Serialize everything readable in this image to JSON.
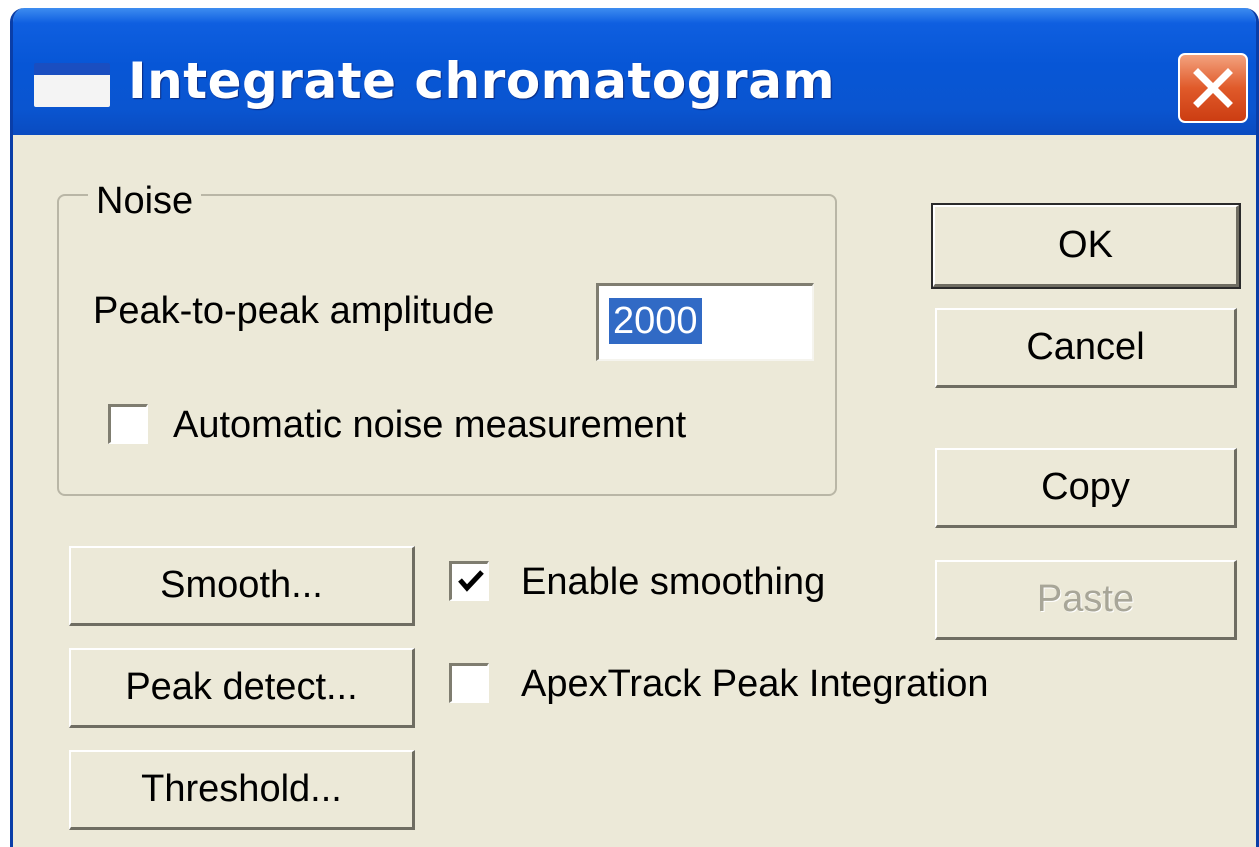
{
  "window": {
    "title": "Integrate chromatogram",
    "title_icon": "window-app-icon",
    "close_icon": "close-icon"
  },
  "noise_group": {
    "legend": "Noise",
    "amplitude_label": "Peak-to-peak amplitude",
    "amplitude_value": "2000",
    "auto_measure_label": "Automatic noise measurement",
    "auto_measure_checked": false
  },
  "options": {
    "enable_smoothing_label": "Enable smoothing",
    "enable_smoothing_checked": true,
    "apextrack_label": "ApexTrack Peak Integration",
    "apextrack_checked": false
  },
  "buttons": {
    "ok": "OK",
    "cancel": "Cancel",
    "copy": "Copy",
    "paste": "Paste",
    "smooth": "Smooth...",
    "peak_detect": "Peak detect...",
    "threshold": "Threshold..."
  },
  "colors": {
    "titlebar": "#0756d6",
    "dialog_bg": "#ece9d8",
    "selection": "#316ac5",
    "close_button": "#e05a2a"
  }
}
